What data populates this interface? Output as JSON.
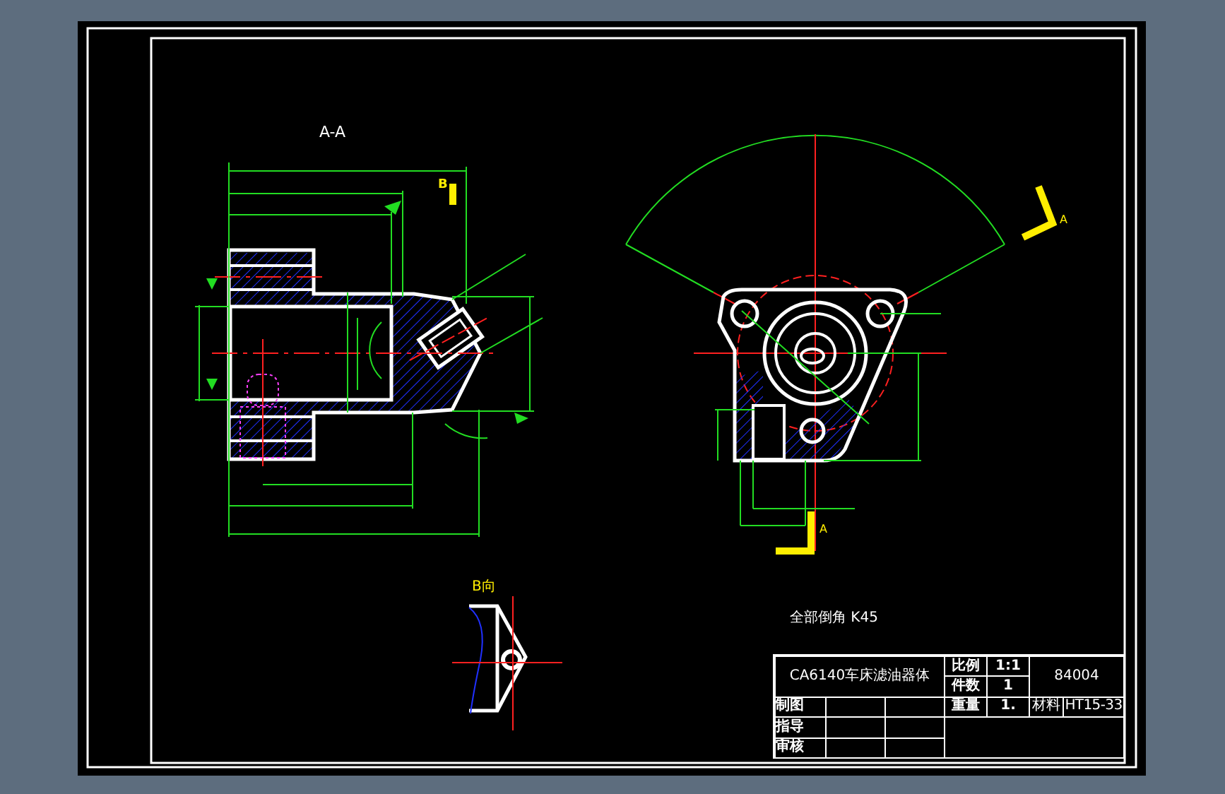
{
  "sheet": {
    "section_title": "A-A",
    "view_arrow_label": "B",
    "view_title": "B向",
    "section_marks": [
      "A",
      "A"
    ],
    "note": "全部倒角 K45"
  },
  "title_block": {
    "part_name": "CA6140车床滤油器体",
    "drawing_no": "84004",
    "fields": [
      {
        "label": "比例",
        "value": "1:1"
      },
      {
        "label": "件数",
        "value": "1"
      },
      {
        "label": "重量",
        "value": "1."
      }
    ],
    "material_label": "材料",
    "material": "HT15-33",
    "signatures": [
      "制图",
      "指导",
      "审核"
    ]
  }
}
